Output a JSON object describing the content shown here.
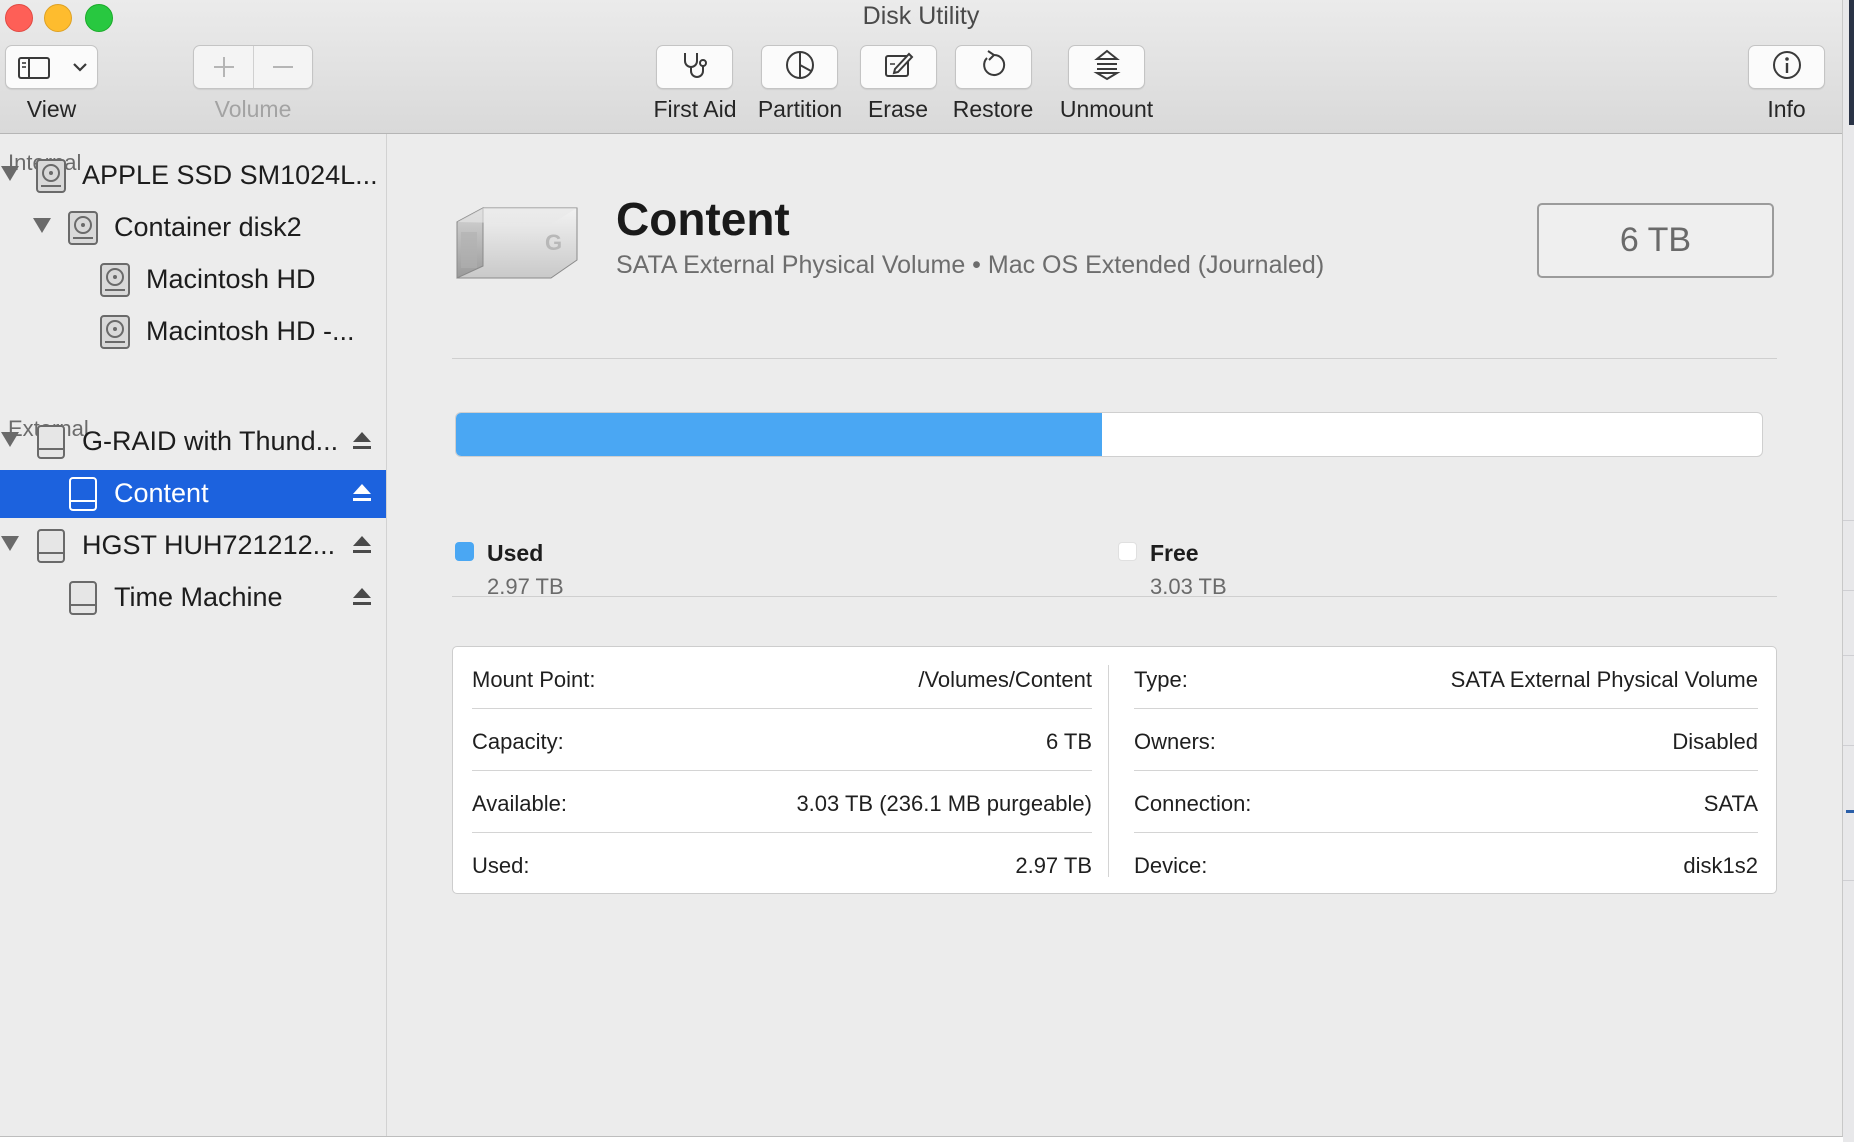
{
  "window": {
    "title": "Disk Utility"
  },
  "toolbar": {
    "view_label": "View",
    "volume_label": "Volume",
    "first_aid_label": "First Aid",
    "partition_label": "Partition",
    "erase_label": "Erase",
    "restore_label": "Restore",
    "unmount_label": "Unmount",
    "info_label": "Info"
  },
  "sidebar": {
    "internal_heading": "Internal",
    "external_heading": "External",
    "items": [
      {
        "label": "APPLE SSD SM1024L...",
        "level": 0,
        "expanded": true,
        "icon": "internal-disk-icon"
      },
      {
        "label": "Container disk2",
        "level": 1,
        "expanded": true,
        "icon": "internal-disk-icon"
      },
      {
        "label": "Macintosh HD",
        "level": 2,
        "icon": "internal-disk-icon"
      },
      {
        "label": "Macintosh HD -...",
        "level": 2,
        "icon": "internal-disk-icon"
      },
      {
        "label": "G-RAID with Thund...",
        "level": 0,
        "expanded": true,
        "icon": "external-disk-icon",
        "eject": true
      },
      {
        "label": "Content",
        "level": 1,
        "selected": true,
        "icon": "external-disk-icon",
        "eject": true
      },
      {
        "label": "HGST HUH721212...",
        "level": 0,
        "expanded": true,
        "icon": "external-disk-icon",
        "eject": true
      },
      {
        "label": "Time Machine",
        "level": 1,
        "icon": "external-disk-icon",
        "eject": true
      }
    ]
  },
  "volume": {
    "name": "Content",
    "subtitle": "SATA External Physical Volume • Mac OS Extended (Journaled)",
    "size": "6 TB",
    "used_fraction": 0.495,
    "used_label": "Used",
    "used_value": "2.97 TB",
    "free_label": "Free",
    "free_value": "3.03 TB",
    "colors": {
      "used": "#4aa7f3",
      "free": "#ffffff",
      "selection": "#1c62de"
    }
  },
  "info": {
    "left": [
      {
        "key": "Mount Point:",
        "value": "/Volumes/Content"
      },
      {
        "key": "Capacity:",
        "value": "6 TB"
      },
      {
        "key": "Available:",
        "value": "3.03 TB (236.1 MB purgeable)"
      },
      {
        "key": "Used:",
        "value": "2.97 TB"
      }
    ],
    "right": [
      {
        "key": "Type:",
        "value": "SATA External Physical Volume"
      },
      {
        "key": "Owners:",
        "value": "Disabled"
      },
      {
        "key": "Connection:",
        "value": "SATA"
      },
      {
        "key": "Device:",
        "value": "disk1s2"
      }
    ]
  }
}
